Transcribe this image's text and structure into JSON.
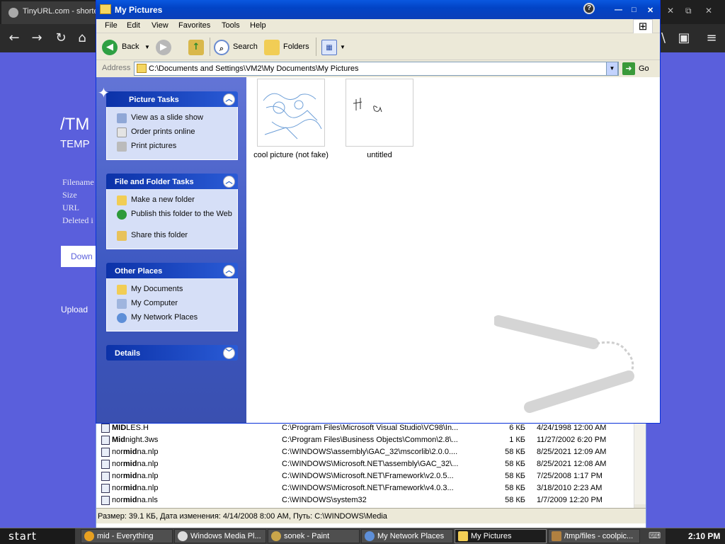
{
  "browser": {
    "tab_title": "TinyURL.com - shorte",
    "site_title": "/TM",
    "site_subtitle": "TEMP",
    "fields": [
      "Filename",
      "Size",
      "URL",
      "Deleted i"
    ],
    "download_label": "Down",
    "upload_label": "Upload"
  },
  "window": {
    "title": "My Pictures",
    "menu": [
      "File",
      "Edit",
      "View",
      "Favorites",
      "Tools",
      "Help"
    ],
    "toolbar": {
      "back": "Back",
      "search": "Search",
      "folders": "Folders"
    },
    "address": {
      "label": "Address",
      "value": "C:\\Documents and Settings\\VM2\\My Documents\\My Pictures",
      "go": "Go"
    }
  },
  "panels": {
    "picture_tasks": {
      "title": "Picture Tasks",
      "items": [
        "View as a slide show",
        "Order prints online",
        "Print pictures"
      ]
    },
    "file_folder_tasks": {
      "title": "File and Folder Tasks",
      "items": [
        "Make a new folder",
        "Publish this folder to the Web",
        "Share this folder"
      ]
    },
    "other_places": {
      "title": "Other Places",
      "items": [
        "My Documents",
        "My Computer",
        "My Network Places"
      ]
    },
    "details": {
      "title": "Details"
    }
  },
  "files": [
    {
      "name": "cool picture (not fake)"
    },
    {
      "name": "untitled"
    }
  ],
  "bg_list": {
    "rows": [
      {
        "pre": "",
        "bold": "MID",
        "post": "LES.H",
        "path": "C:\\Program Files\\Microsoft Visual Studio\\VC98\\In...",
        "size": "6 КБ",
        "date": "4/24/1998 12:00 AM"
      },
      {
        "pre": "",
        "bold": "Mid",
        "post": "night.3ws",
        "path": "C:\\Program Files\\Business Objects\\Common\\2.8\\...",
        "size": "1 КБ",
        "date": "11/27/2002 6:20 PM"
      },
      {
        "pre": "nor",
        "bold": "mid",
        "post": "na.nlp",
        "path": "C:\\WINDOWS\\assembly\\GAC_32\\mscorlib\\2.0.0....",
        "size": "58 КБ",
        "date": "8/25/2021 12:09 AM"
      },
      {
        "pre": "nor",
        "bold": "mid",
        "post": "na.nlp",
        "path": "C:\\WINDOWS\\Microsoft.NET\\assembly\\GAC_32\\...",
        "size": "58 КБ",
        "date": "8/25/2021 12:08 AM"
      },
      {
        "pre": "nor",
        "bold": "mid",
        "post": "na.nlp",
        "path": "C:\\WINDOWS\\Microsoft.NET\\Framework\\v2.0.5...",
        "size": "58 КБ",
        "date": "7/25/2008 1:17 PM"
      },
      {
        "pre": "nor",
        "bold": "mid",
        "post": "na.nlp",
        "path": "C:\\WINDOWS\\Microsoft.NET\\Framework\\v4.0.3...",
        "size": "58 КБ",
        "date": "3/18/2010 2:23 AM"
      },
      {
        "pre": "nor",
        "bold": "mid",
        "post": "na.nls",
        "path": "C:\\WINDOWS\\system32",
        "size": "58 КБ",
        "date": "1/7/2009 12:20 PM"
      }
    ],
    "status": "Размер: 39.1 КБ, Дата изменения: 4/14/2008 8:00 AM, Путь: C:\\WINDOWS\\Media"
  },
  "taskbar": {
    "start": "start",
    "buttons": [
      "mid - Everything",
      "Windows Media Pl...",
      "sonek - Paint",
      "My Network Places",
      "My Pictures",
      "/tmp/files - coolpic..."
    ],
    "clock": "2:10 PM"
  },
  "colors": {
    "title_bar": "#0244c6",
    "task_pane": "#3a56c0",
    "browser_bg": "#5a5fdc"
  }
}
